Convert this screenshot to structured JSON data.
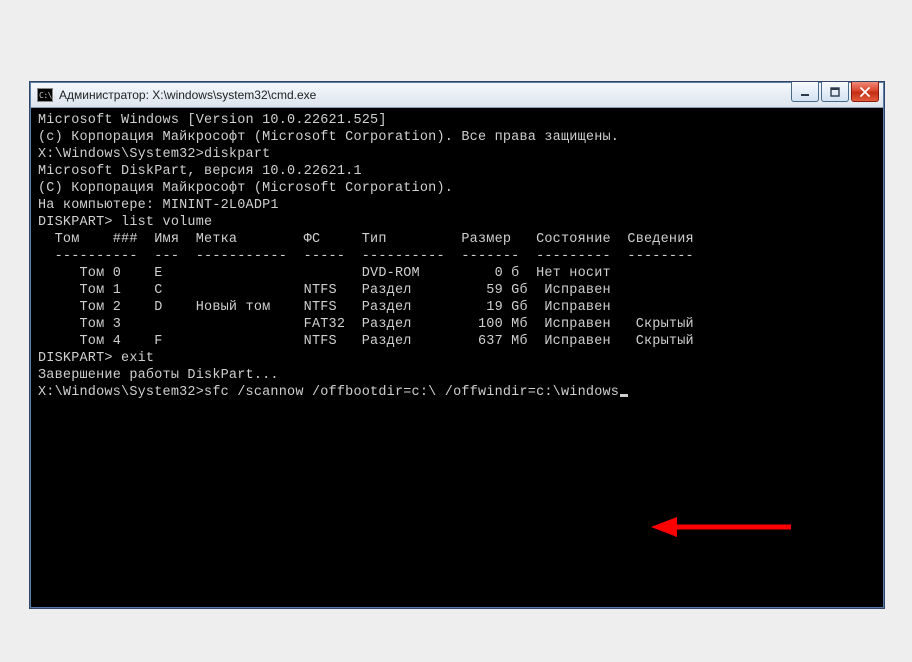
{
  "window": {
    "title_prefix": "Администратор: ",
    "title_path": "X:\\windows\\system32\\cmd.exe",
    "icon_glyph": "C:\\."
  },
  "terminal": {
    "lines": [
      "Microsoft Windows [Version 10.0.22621.525]",
      "(c) Корпорация Майкрософт (Microsoft Corporation). Все права защищены.",
      "",
      "X:\\Windows\\System32>diskpart",
      "",
      "Microsoft DiskPart, версия 10.0.22621.1",
      "",
      "(C) Корпорация Майкрософт (Microsoft Corporation).",
      "На компьютере: MININT-2L0ADP1",
      "",
      "DISKPART> list volume",
      "",
      "  Том    ###  Имя  Метка        ФС     Тип         Размер   Состояние  Сведения",
      "  ----------  ---  -----------  -----  ----------  -------  ---------  --------",
      "     Том 0    E                        DVD-ROM         0 б  Нет носит",
      "     Том 1    C                 NTFS   Раздел         59 Gб  Исправен",
      "     Том 2    D    Новый том    NTFS   Раздел         19 Gб  Исправен",
      "     Том 3                      FAT32  Раздел        100 Мб  Исправен   Скрытый",
      "     Том 4    F                 NTFS   Раздел        637 Мб  Исправен   Скрытый",
      "",
      "DISKPART> exit",
      "",
      "Завершение работы DiskPart...",
      "",
      "X:\\Windows\\System32>sfc /scannow /offbootdir=c:\\ /offwindir=c:\\windows"
    ],
    "cursor_on_last": true
  },
  "volumes": [
    {
      "num": 0,
      "ltr": "E",
      "label": "",
      "fs": "",
      "type": "DVD-ROM",
      "size": "0 б",
      "status": "Нет носит",
      "info": ""
    },
    {
      "num": 1,
      "ltr": "C",
      "label": "",
      "fs": "NTFS",
      "type": "Раздел",
      "size": "59 Gб",
      "status": "Исправен",
      "info": ""
    },
    {
      "num": 2,
      "ltr": "D",
      "label": "Новый том",
      "fs": "NTFS",
      "type": "Раздел",
      "size": "19 Gб",
      "status": "Исправен",
      "info": ""
    },
    {
      "num": 3,
      "ltr": "",
      "label": "",
      "fs": "FAT32",
      "type": "Раздел",
      "size": "100 Мб",
      "status": "Исправен",
      "info": "Скрытый"
    },
    {
      "num": 4,
      "ltr": "F",
      "label": "",
      "fs": "NTFS",
      "type": "Раздел",
      "size": "637 Мб",
      "status": "Исправен",
      "info": "Скрытый"
    }
  ],
  "annotation": {
    "arrow_color": "#ff0000"
  }
}
